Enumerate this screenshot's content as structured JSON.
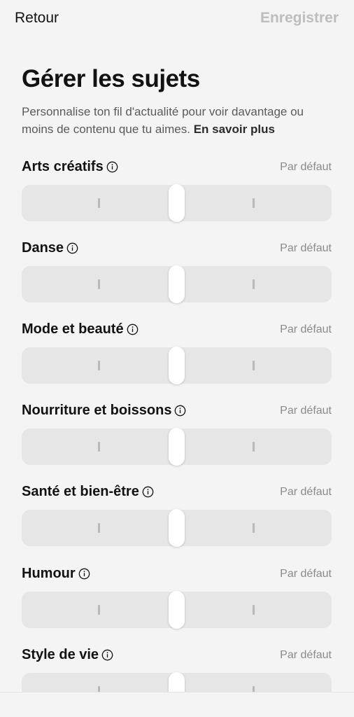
{
  "nav": {
    "back_label": "Retour",
    "save_label": "Enregistrer"
  },
  "header": {
    "title": "Gérer les sujets",
    "description": "Personnalise ton fil d'actualité pour voir davantage ou moins de contenu que tu aimes. ",
    "learn_more": "En savoir plus"
  },
  "topics": [
    {
      "name": "Arts créatifs",
      "status": "Par défaut",
      "level": 0.5
    },
    {
      "name": "Danse",
      "status": "Par défaut",
      "level": 0.5
    },
    {
      "name": "Mode et beauté",
      "status": "Par défaut",
      "level": 0.5
    },
    {
      "name": "Nourriture et boissons",
      "status": "Par défaut",
      "level": 0.5
    },
    {
      "name": "Santé et bien-être",
      "status": "Par défaut",
      "level": 0.5
    },
    {
      "name": "Humour",
      "status": "Par défaut",
      "level": 0.5
    },
    {
      "name": "Style de vie",
      "status": "Par défaut",
      "level": 0.5
    }
  ],
  "icons": {
    "info": "info-circle-icon"
  },
  "colors": {
    "background": "#f4f4f4",
    "track": "#e6e6e6",
    "thumb": "#ffffff",
    "muted_text": "#8a8a8a",
    "disabled_save": "#bdbdbd"
  }
}
